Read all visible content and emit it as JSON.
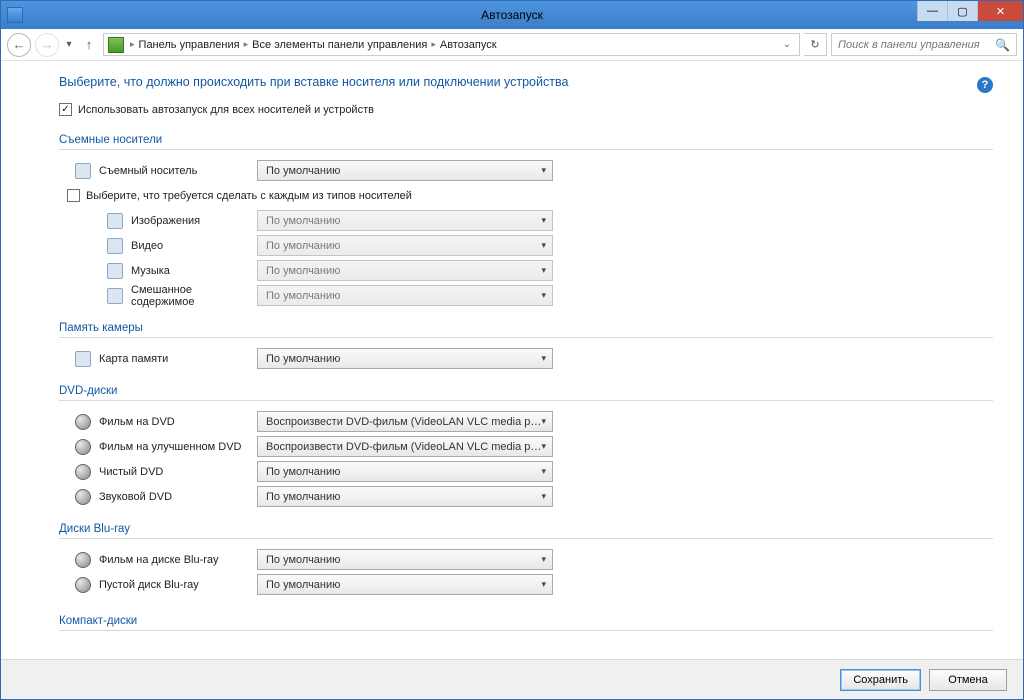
{
  "window": {
    "title": "Автозапуск"
  },
  "breadcrumb": {
    "items": [
      "Панель управления",
      "Все элементы панели управления",
      "Автозапуск"
    ]
  },
  "search": {
    "placeholder": "Поиск в панели управления"
  },
  "heading": "Выберите, что должно происходить при вставке носителя или подключении устройства",
  "use_autoplay_label": "Использовать автозапуск для всех носителей и устройств",
  "sections": {
    "removable": {
      "title": "Съемные носители",
      "item_label": "Съемный носитель",
      "item_value": "По умолчанию",
      "choose_each_label": "Выберите, что требуется сделать с каждым из типов носителей",
      "subitems": [
        {
          "label": "Изображения",
          "value": "По умолчанию"
        },
        {
          "label": "Видео",
          "value": "По умолчанию"
        },
        {
          "label": "Музыка",
          "value": "По умолчанию"
        },
        {
          "label": "Смешанное содержимое",
          "value": "По умолчанию"
        }
      ]
    },
    "camera": {
      "title": "Память камеры",
      "item_label": "Карта памяти",
      "item_value": "По умолчанию"
    },
    "dvd": {
      "title": "DVD-диски",
      "items": [
        {
          "label": "Фильм на DVD",
          "value": "Воспроизвести DVD-фильм (VideoLAN VLC media player)"
        },
        {
          "label": "Фильм на улучшенном DVD",
          "value": "Воспроизвести DVD-фильм (VideoLAN VLC media player)"
        },
        {
          "label": "Чистый DVD",
          "value": "По умолчанию"
        },
        {
          "label": "Звуковой DVD",
          "value": "По умолчанию"
        }
      ]
    },
    "bluray": {
      "title": "Диски Blu-ray",
      "items": [
        {
          "label": "Фильм на диске Blu-ray",
          "value": "По умолчанию"
        },
        {
          "label": "Пустой диск Blu-ray",
          "value": "По умолчанию"
        }
      ]
    },
    "cd": {
      "title": "Компакт-диски"
    }
  },
  "buttons": {
    "save": "Сохранить",
    "cancel": "Отмена"
  }
}
